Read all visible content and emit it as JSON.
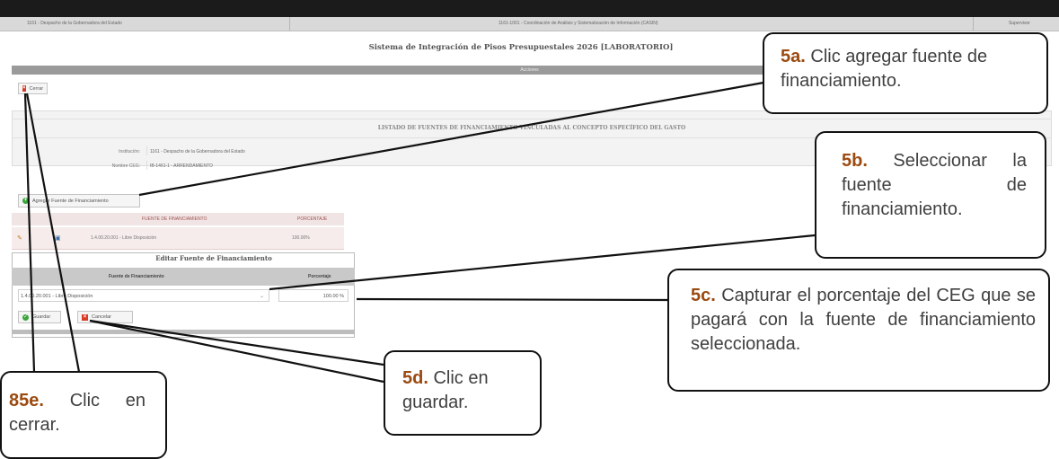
{
  "header": {
    "institution": "1161 - Despacho de la Gobernadora del Estado",
    "unit": "1161-1001 - Coordinación de Análisis y Sistematización de Información (CASIN)",
    "role": "Supervisor"
  },
  "app_title": "Sistema de Integración de Pisos Presupuestales 2026 [LABORATORIO]",
  "actions_label": "Acciones",
  "close_button": "Cerrar",
  "listado_title": "LISTADO DE FUENTES DE FINANCIAMIENTO VINCULADAS AL CONCEPTO ESPECÍFICO DEL GASTO",
  "fields": {
    "institution_label": "Institución:",
    "institution_value": "1161 - Despacho de la Gobernadora del Estado",
    "ceg_label": "Nombre CEG:",
    "ceg_value": "IB-1461-1 - ARRENDAMIENTO"
  },
  "add_source_button": "Agregar Fuente de Financiamiento",
  "grid": {
    "headers": [
      "FUENTE DE FINANCIAMIENTO",
      "PORCENTAJE"
    ],
    "rows": [
      {
        "fuente": "1.4.00.20.001 - Libre Disposición",
        "porcentaje": "100.00%"
      }
    ]
  },
  "edit": {
    "title": "Editar Fuente de Financiamiento",
    "col_fuente": "Fuente de Financiamiento",
    "col_pct": "Porcentaje",
    "selected": "1.4.00.20.001 - Libre Disposición",
    "percentage": "100.00 %",
    "save_label": "Guardar",
    "cancel_label": "Cancelar"
  },
  "callouts": {
    "c5a_num": "5a.",
    "c5a_text": "Clic agregar fuente de financiamiento.",
    "c5b_num": "5b.",
    "c5b_text": "Seleccionar la fuente de financiamiento.",
    "c5c_num": "5c.",
    "c5c_text": "Capturar el porcentaje del CEG que se pagará con la fuente de financiamiento seleccionada.",
    "c5d_num": "5d.",
    "c5d_text": "Clic en guardar.",
    "c85e_num": "85e.",
    "c85e_text": "Clic en cerrar."
  },
  "colors": {
    "callout_number": "#9b4a10",
    "close_icon": "#d93b26",
    "add_icon": "#3aa53a"
  }
}
